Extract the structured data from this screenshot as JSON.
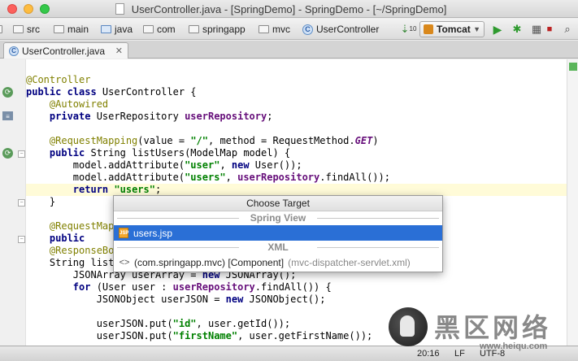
{
  "window": {
    "title": "UserController.java - [SpringDemo] - SpringDemo - [~/SpringDemo]"
  },
  "breadcrumbs": [
    "src",
    "main",
    "java",
    "com",
    "springapp",
    "mvc",
    "UserController"
  ],
  "toolbar": {
    "run_config": "Tomcat"
  },
  "tabs": [
    {
      "label": "UserController.java",
      "active": true
    }
  ],
  "code_lines": [
    "",
    "@Controller",
    "public class UserController {",
    "    @Autowired",
    "    private UserRepository userRepository;",
    "",
    "    @RequestMapping(value = \"/\", method = RequestMethod.GET)",
    "    public String listUsers(ModelMap model) {",
    "        model.addAttribute(\"user\", new User());",
    "        model.addAttribute(\"users\", userRepository.findAll());",
    "        return \"users\";",
    "    }",
    "",
    "    @RequestMap",
    "    public",
    "    @ResponseBo",
    "    String list",
    "        JSONArray userArray = new JSONArray();",
    "        for (User user : userRepository.findAll()) {",
    "            JSONObject userJSON = new JSONObject();",
    "",
    "            userJSON.put(\"id\", user.getId());",
    "            userJSON.put(\"firstName\", user.getFirstName());"
  ],
  "popup": {
    "title": "Choose Target",
    "groups": [
      {
        "name": "Spring View",
        "items": [
          {
            "label": "users.jsp",
            "detail": "",
            "selected": true
          }
        ]
      },
      {
        "name": "XML",
        "items": [
          {
            "label": "(com.springapp.mvc) [Component]",
            "detail": "(mvc-dispatcher-servlet.xml)",
            "selected": false
          }
        ]
      }
    ]
  },
  "status": {
    "position": "20:16",
    "line_sep": "LF",
    "encoding": "UTF-8"
  },
  "watermark": {
    "text": "黑区网络",
    "url": "www.heiqu.com"
  },
  "colors": {
    "selection": "#2a6fd6",
    "caret_line": "#fffbd8",
    "keyword": "#000080",
    "annotation": "#808000",
    "string": "#008000"
  }
}
